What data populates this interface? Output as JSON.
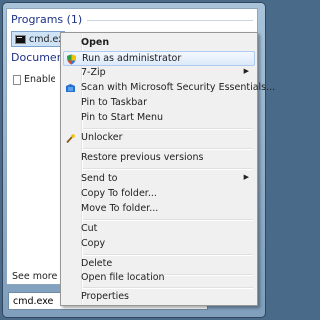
{
  "start_panel": {
    "programs_header": "Programs (1)",
    "program_result": "cmd.exe",
    "documents_header": "Documents",
    "document_item": "Enable a",
    "see_more": "See more r",
    "search_value": "cmd.exe",
    "clear_glyph": "×"
  },
  "context_menu": {
    "items": [
      {
        "label": "Open",
        "bold": true
      },
      {
        "label": "Run as administrator",
        "icon": "uac-shield-icon",
        "highlighted": true
      },
      {
        "label": "7-Zip",
        "submenu": true
      },
      {
        "label": "Scan with Microsoft Security Essentials...",
        "icon": "security-essentials-icon"
      },
      {
        "label": "Pin to Taskbar"
      },
      {
        "label": "Pin to Start Menu"
      },
      {
        "label": "Unlocker",
        "icon": "unlocker-wand-icon"
      },
      {
        "label": "Restore previous versions"
      },
      {
        "label": "Send to",
        "submenu": true
      },
      {
        "label": "Copy To folder..."
      },
      {
        "label": "Move To folder..."
      },
      {
        "label": "Cut"
      },
      {
        "label": "Copy"
      },
      {
        "label": "Delete"
      },
      {
        "label": "Open file location"
      },
      {
        "label": "Properties"
      }
    ],
    "submenu_arrow": "▶"
  }
}
